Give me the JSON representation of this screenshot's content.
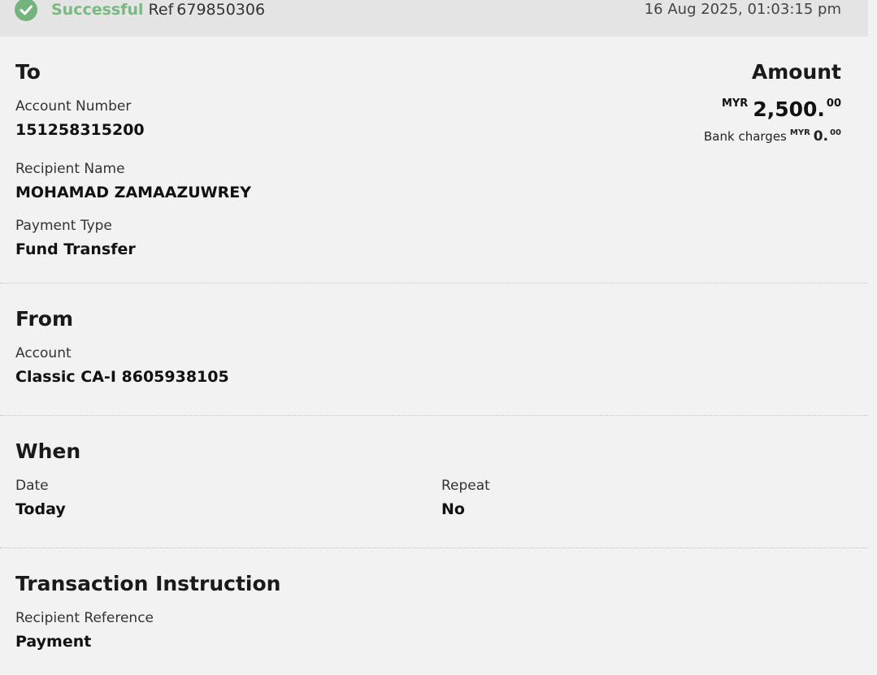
{
  "status": {
    "state": "Successful",
    "ref_label": "Ref",
    "ref_number": "679850306",
    "timestamp": "16 Aug 2025, 01:03:15 pm",
    "success_color": "#74b27e",
    "icon": "check-circle-icon"
  },
  "to": {
    "heading": "To",
    "account_number_label": "Account Number",
    "account_number": "151258315200",
    "recipient_name_label": "Recipient Name",
    "recipient_name": "MOHAMAD ZAMAAZUWREY",
    "payment_type_label": "Payment Type",
    "payment_type": "Fund Transfer"
  },
  "amount": {
    "heading": "Amount",
    "currency": "MYR",
    "whole": "2,500.",
    "cents": "00",
    "bank_charges_label": "Bank charges",
    "bank_charges_currency": "MYR",
    "bank_charges_whole": "0.",
    "bank_charges_cents": "00"
  },
  "from": {
    "heading": "From",
    "account_label": "Account",
    "account": "Classic CA-I 8605938105"
  },
  "when": {
    "heading": "When",
    "date_label": "Date",
    "date": "Today",
    "repeat_label": "Repeat",
    "repeat": "No"
  },
  "instruction": {
    "heading": "Transaction Instruction",
    "recipient_reference_label": "Recipient Reference",
    "recipient_reference": "Payment"
  }
}
